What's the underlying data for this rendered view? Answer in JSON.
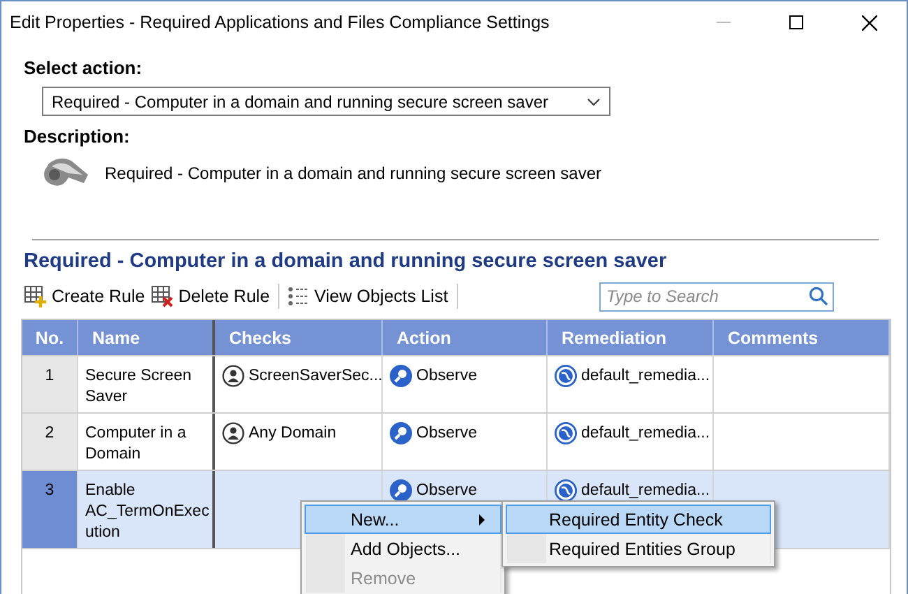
{
  "window": {
    "title": "Edit Properties - Required Applications and Files Compliance Settings"
  },
  "select_action": {
    "label": "Select action:",
    "value": "Required - Computer in a domain and running secure screen saver"
  },
  "description": {
    "label": "Description:",
    "text": "Required - Computer in a domain and running secure screen saver"
  },
  "section_title": "Required - Computer in a domain and running secure screen saver",
  "toolbar": [
    {
      "kind": "create",
      "label": "Create Rule"
    },
    {
      "kind": "delete",
      "label": "Delete Rule"
    },
    {
      "kind": "list",
      "label": "View Objects List"
    }
  ],
  "search": {
    "placeholder": "Type to Search"
  },
  "table": {
    "columns": [
      "No.",
      "Name",
      "Checks",
      "Action",
      "Remediation",
      "Comments"
    ],
    "rows": [
      {
        "no": "1",
        "name": "Secure Screen Saver",
        "checks": "ScreenSaverSec...",
        "action": "Observe",
        "remediation": "default_remedia...",
        "selected": false
      },
      {
        "no": "2",
        "name": "Computer in a Domain",
        "checks": "Any Domain",
        "action": "Observe",
        "remediation": "default_remedia...",
        "selected": false
      },
      {
        "no": "3",
        "name": "Enable AC_TermOnExecution",
        "action": "Observe",
        "remediation": "default_remedia...",
        "selected": true
      }
    ]
  },
  "context_menu": {
    "items": [
      {
        "label": "New...",
        "selected": true,
        "disabled": false,
        "submenu": true
      },
      {
        "label": "Add Objects...",
        "selected": false,
        "disabled": false,
        "submenu": false
      },
      {
        "label": "Remove",
        "selected": false,
        "disabled": true,
        "submenu": false
      }
    ]
  },
  "submenu": {
    "items": [
      {
        "label": "Required Entity Check",
        "selected": true
      },
      {
        "label": "Required Entities Group",
        "selected": false
      }
    ]
  }
}
